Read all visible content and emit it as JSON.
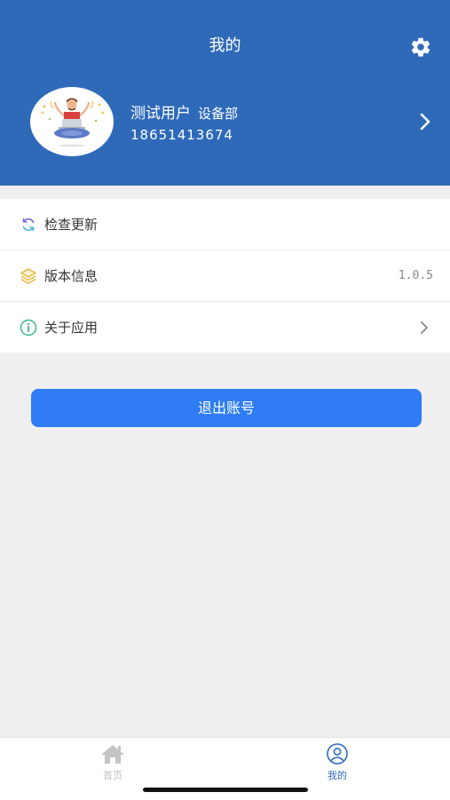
{
  "header": {
    "title": "我的",
    "settings_icon": "gear-icon",
    "background": "#2f6ab9"
  },
  "profile": {
    "name": "测试用户",
    "department": "设备部",
    "phone": "18651413674"
  },
  "menu": {
    "items": [
      {
        "label": "检查更新",
        "icon": "refresh-icon"
      },
      {
        "label": "版本信息",
        "icon": "layers-icon",
        "value": "1.0.5"
      },
      {
        "label": "关于应用",
        "icon": "info-icon"
      }
    ]
  },
  "logout": {
    "label": "退出账号",
    "color": "#2f7cf6"
  },
  "tabbar": {
    "tabs": [
      {
        "label": "首页",
        "icon": "home-icon",
        "active": false
      },
      {
        "label": "我的",
        "icon": "user-icon",
        "active": true
      }
    ],
    "active_color": "#2f6ab9",
    "inactive_color": "#bfbfbf"
  }
}
